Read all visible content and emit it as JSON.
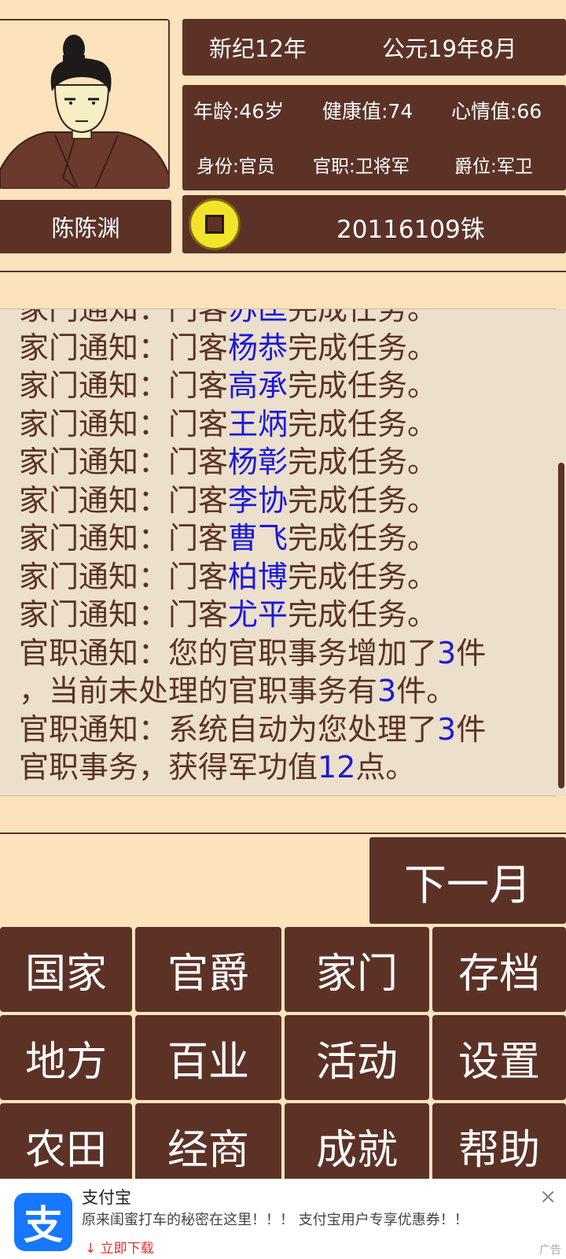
{
  "header": {
    "era_date": "新纪12年",
    "greg_date": "公元19年8月"
  },
  "stats": {
    "age": "年龄:46岁",
    "health": "健康值:74",
    "mood": "心情值:66",
    "identity": "身份:官员",
    "office": "官职:卫将军",
    "rank": "爵位:军卫"
  },
  "player": {
    "name": "陈陈渊"
  },
  "money": {
    "amount": "20116109铢"
  },
  "log": [
    {
      "pre": "家门通知：门客",
      "hl": "苏匡",
      "post": "完成任务。"
    },
    {
      "pre": "家门通知：门客",
      "hl": "杨恭",
      "post": "完成任务。"
    },
    {
      "pre": "家门通知：门客",
      "hl": "高承",
      "post": "完成任务。"
    },
    {
      "pre": "家门通知：门客",
      "hl": "王炳",
      "post": "完成任务。"
    },
    {
      "pre": "家门通知：门客",
      "hl": "杨彰",
      "post": "完成任务。"
    },
    {
      "pre": "家门通知：门客",
      "hl": "李协",
      "post": "完成任务。"
    },
    {
      "pre": "家门通知：门客",
      "hl": "曹飞",
      "post": "完成任务。"
    },
    {
      "pre": "家门通知：门客",
      "hl": "柏博",
      "post": "完成任务。"
    },
    {
      "pre": "家门通知：门客",
      "hl": "尤平",
      "post": "完成任务。"
    },
    {
      "pre": "官职通知：您的官职事务增加了",
      "hl": "3",
      "post": "件"
    },
    {
      "pre": "，当前未处理的官职事务有",
      "hl": "3",
      "post": "件。"
    },
    {
      "pre": "官职通知：系统自动为您处理了",
      "hl": "3",
      "post": "件"
    },
    {
      "pre": "官职事务，获得军功值",
      "hl": "12",
      "post": "点。"
    }
  ],
  "next_button": "下一月",
  "menu": [
    "国家",
    "官爵",
    "家门",
    "存档",
    "地方",
    "百业",
    "活动",
    "设置",
    "农田",
    "经商",
    "成就",
    "帮助"
  ],
  "ad": {
    "logo": "支",
    "title": "支付宝",
    "text": "原来闺蜜打车的秘密在这里！！！ 支付宝用户专享优惠券！！",
    "cta": "立即下载",
    "tag": "广告",
    "close": "×"
  },
  "colors": {
    "panel": "#5c3227",
    "background": "#fde3bc",
    "highlight": "#1a1ad6",
    "coin": "#f3e32a"
  }
}
